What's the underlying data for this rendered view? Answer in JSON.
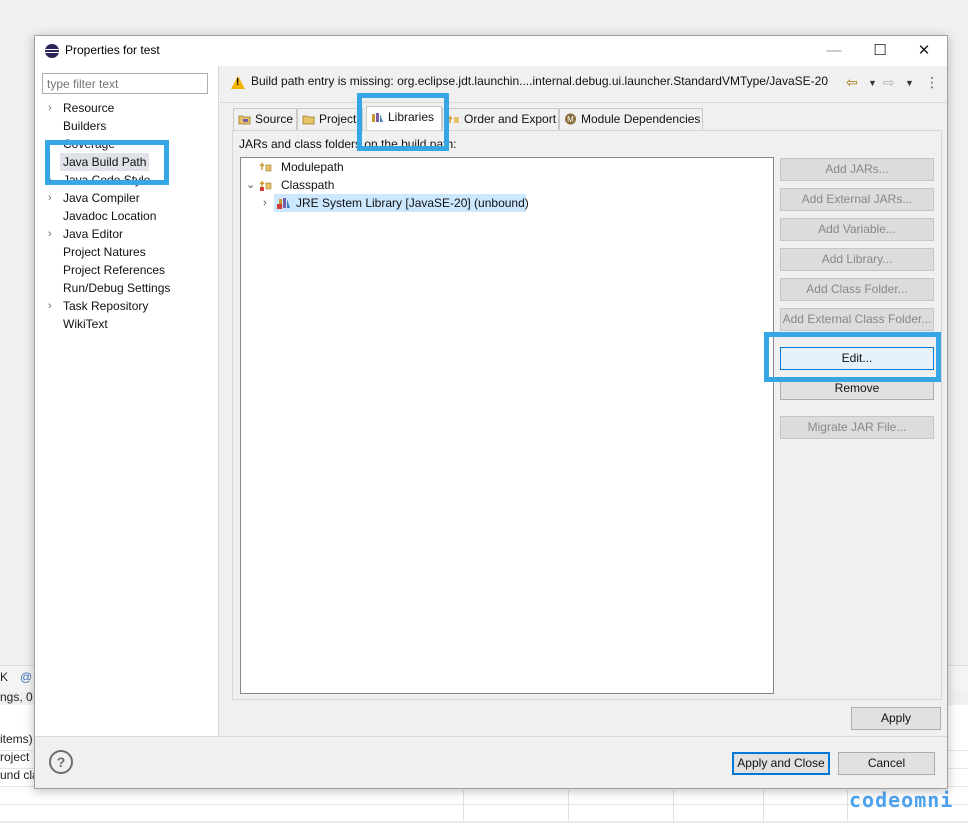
{
  "window": {
    "title": "Properties for test",
    "minimize_glyph": "—",
    "maximize_glyph": "☐",
    "close_glyph": "✕"
  },
  "filter": {
    "placeholder": "type filter text"
  },
  "nav_tree": [
    {
      "label": "Resource",
      "expandable": true
    },
    {
      "label": "Builders",
      "expandable": false
    },
    {
      "label": "Coverage",
      "expandable": false
    },
    {
      "label": "Java Build Path",
      "expandable": false,
      "selected": true
    },
    {
      "label": "Java Code Style",
      "expandable": true
    },
    {
      "label": "Java Compiler",
      "expandable": true
    },
    {
      "label": "Javadoc Location",
      "expandable": false
    },
    {
      "label": "Java Editor",
      "expandable": true
    },
    {
      "label": "Project Natures",
      "expandable": false
    },
    {
      "label": "Project References",
      "expandable": false
    },
    {
      "label": "Run/Debug Settings",
      "expandable": false
    },
    {
      "label": "Task Repository",
      "expandable": true
    },
    {
      "label": "WikiText",
      "expandable": false
    }
  ],
  "header": {
    "warning": "Build path entry is missing: org.eclipse.jdt.launchin....internal.debug.ui.launcher.StandardVMType/JavaSE-20"
  },
  "tabs": [
    {
      "label": "Source",
      "mnemonic": "S"
    },
    {
      "label": "Projects",
      "mnemonic": "j"
    },
    {
      "label": "Libraries",
      "mnemonic": "L",
      "active": true
    },
    {
      "label": "Order and Export",
      "mnemonic": "O"
    },
    {
      "label": "Module Dependencies",
      "mnemonic": "M"
    }
  ],
  "panel": {
    "label": "JARs and class folders on the build path:",
    "entries": [
      {
        "label": "Modulepath",
        "level": 0,
        "expanded": false
      },
      {
        "label": "Classpath",
        "level": 0,
        "expanded": true
      },
      {
        "label": "JRE System Library [JavaSE-20] (unbound)",
        "level": 1,
        "expanded": false,
        "selected": true
      }
    ]
  },
  "buttons": {
    "add_jars": "Add JARs...",
    "add_external_jars": "Add External JARs...",
    "add_variable": "Add Variable...",
    "add_library": "Add Library...",
    "add_class_folder": "Add Class Folder...",
    "add_external_class_folder": "Add External Class Folder...",
    "edit": "Edit...",
    "remove": "Remove",
    "migrate_jar": "Migrate JAR File...",
    "apply": "Apply",
    "apply_and_close": "Apply and Close",
    "cancel": "Cancel"
  },
  "background": {
    "tab_glyph_1": "K",
    "tab_glyph_2": "@",
    "status_snippet": "ngs, 0",
    "row_snippets": [
      "items)",
      "roject",
      "und cla"
    ]
  },
  "watermark": "codeomni",
  "colors": {
    "highlight": "#35a6e6",
    "selection": "#cce8ff",
    "focus": "#0078d7",
    "warning": "#f2b400"
  }
}
